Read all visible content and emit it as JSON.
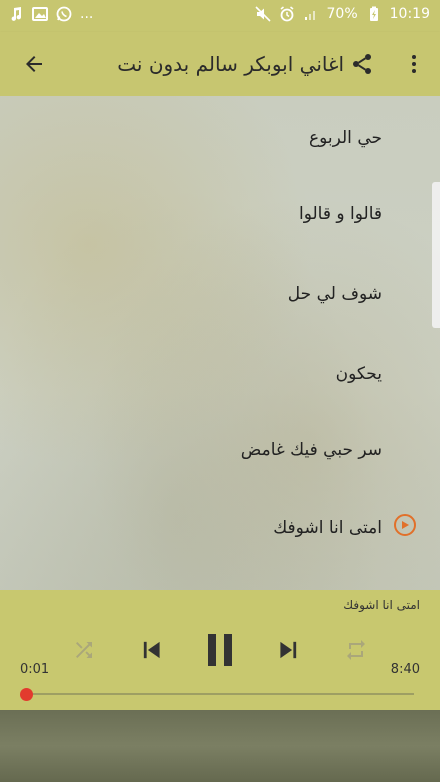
{
  "status_bar": {
    "left_icons": [
      "music-note-icon",
      "image-icon",
      "whatsapp-icon"
    ],
    "ellipsis": "...",
    "battery": "70%",
    "time": "10:19"
  },
  "toolbar": {
    "title": "اغاني ابوبكر سالم بدون نت"
  },
  "songs": [
    "حي الربوع",
    "قالوا و قالوا",
    "شوف لي حل",
    "يحكون",
    "سر حبي فيك غامض",
    "امتى انا اشوفك"
  ],
  "player": {
    "now_playing": "امتى انا اشوفك",
    "elapsed": "0:01",
    "duration": "8:40",
    "progress": 0.002
  },
  "colors": {
    "accent": "#c7c670",
    "play_indicator": "#e1702a",
    "seek_thumb": "#e23b2e"
  }
}
